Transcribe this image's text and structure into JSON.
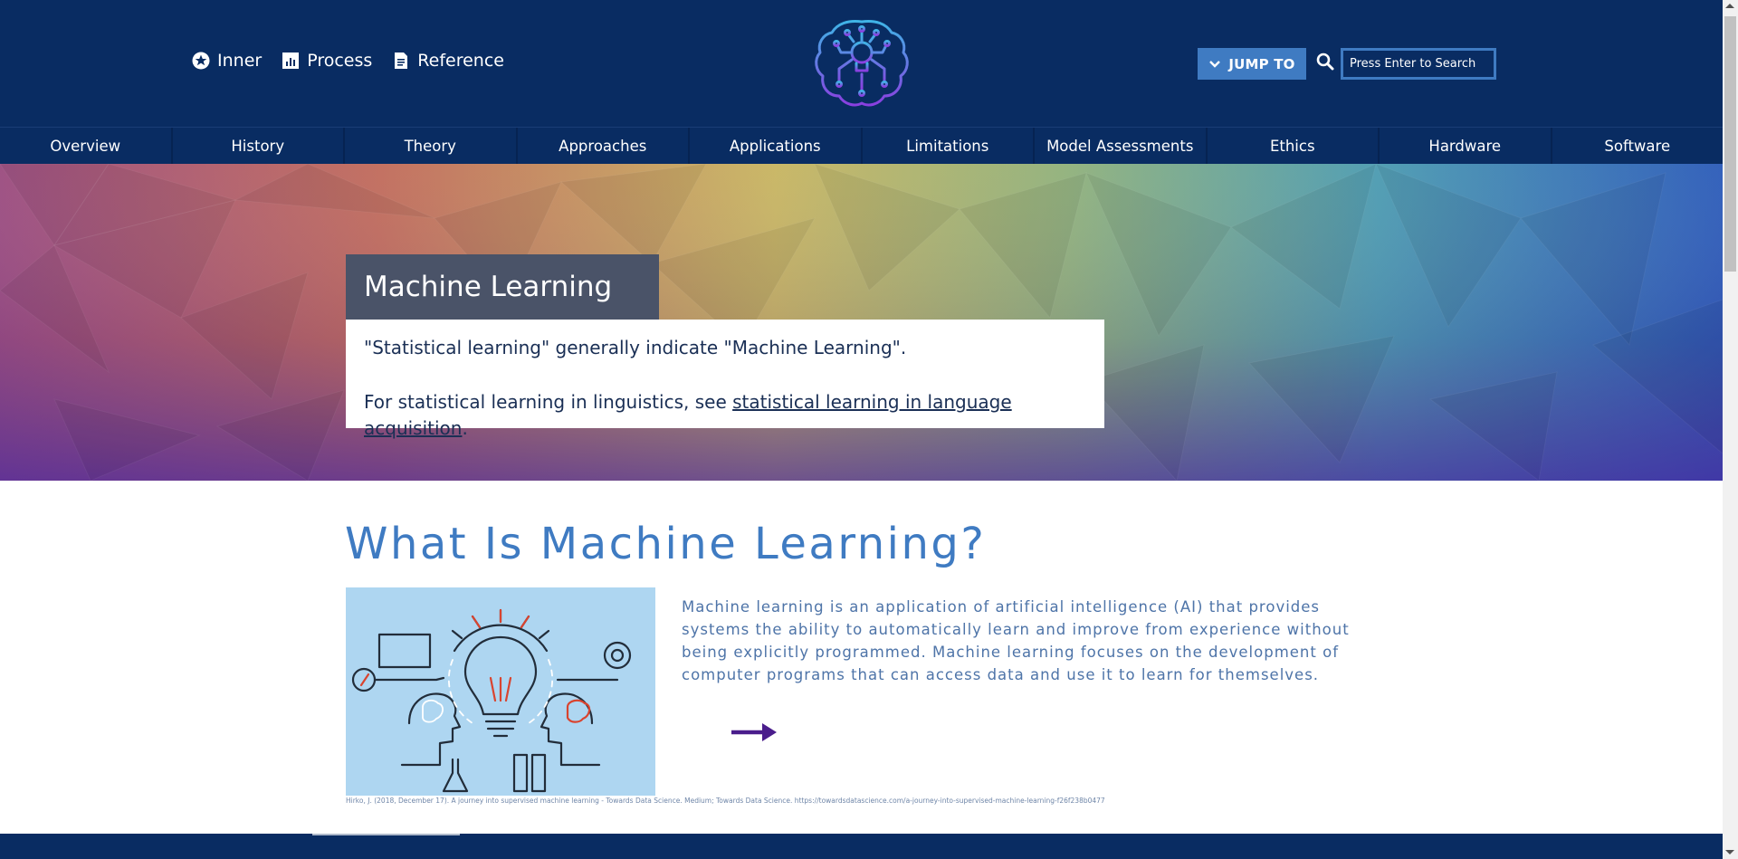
{
  "header": {
    "utility_nav": [
      {
        "label": "Inner",
        "icon": "star-circle-icon"
      },
      {
        "label": "Process",
        "icon": "bar-chart-icon"
      },
      {
        "label": "Reference",
        "icon": "document-icon"
      }
    ],
    "logo": "brain-circuit-lightbulb-logo",
    "jump_to_label": "JUMP TO",
    "search_placeholder": "Press Enter to Search"
  },
  "main_nav": [
    {
      "label": "Overview"
    },
    {
      "label": "History"
    },
    {
      "label": "Theory"
    },
    {
      "label": "Approaches"
    },
    {
      "label": "Applications"
    },
    {
      "label": "Limitations"
    },
    {
      "label": "Model Assessments"
    },
    {
      "label": "Ethics"
    },
    {
      "label": "Hardware"
    },
    {
      "label": "Software"
    }
  ],
  "hero": {
    "title": "Machine Learning",
    "note_line1": "\"Statistical learning\" generally indicate \"Machine Learning\".",
    "note_line2_prefix": "For statistical learning in linguistics, see ",
    "note_link": "statistical learning in language acquisition",
    "note_line2_suffix": "."
  },
  "section": {
    "title": "What Is Machine Learning?",
    "description": "Machine learning is an application of artificial intelligence (AI) that provides systems the ability to automatically learn and improve from experience without being explicitly programmed. Machine learning focuses on the development of computer programs that can access data and use it to learn for themselves.",
    "citation": "Hirko, J. (2018, December 17). A journey into supervised machine learning - Towards Data Science. Medium; Towards Data Science. https://towardsdatascience.com/a-journey-into-supervised-machine-learning-f26f238b0477"
  },
  "colors": {
    "header_bg": "#092c62",
    "accent_blue": "#3f7bc2",
    "title_box": "#4a5368",
    "arrow_purple": "#4a1d8c",
    "illustration_bg": "#aed6f1"
  }
}
